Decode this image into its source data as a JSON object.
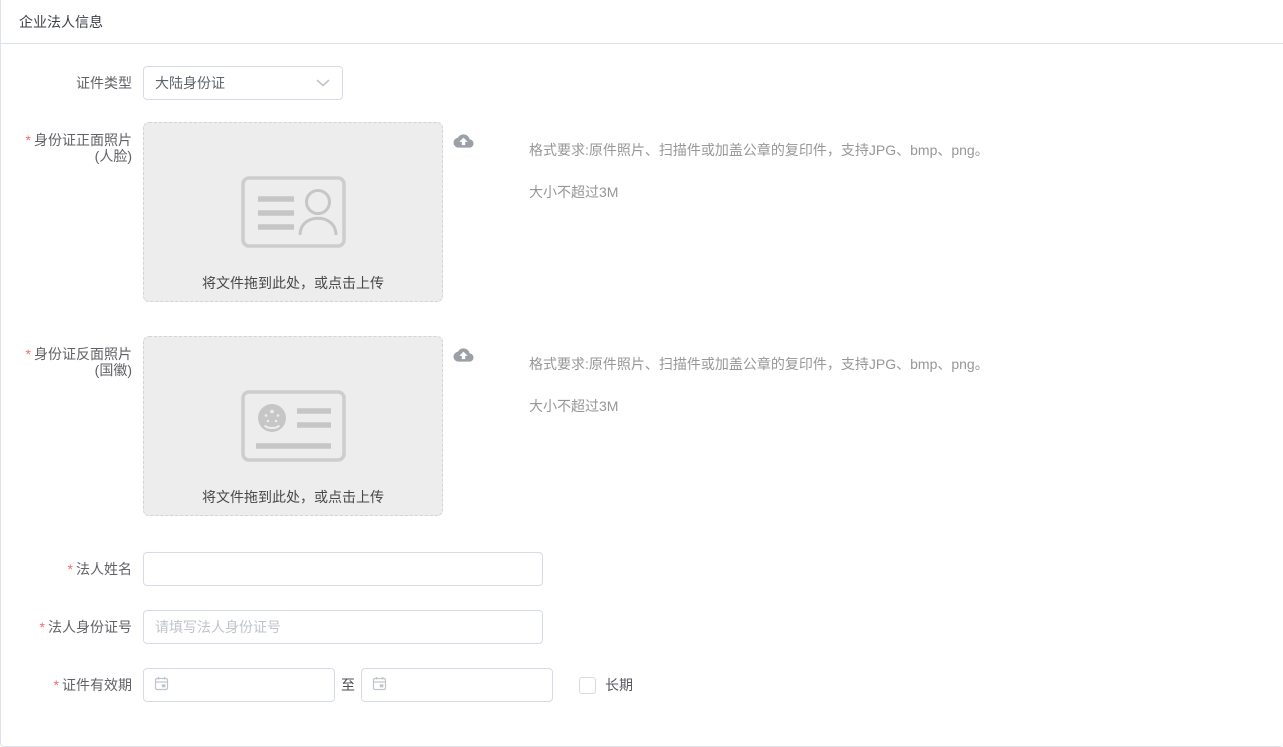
{
  "colors": {
    "panel_border": "#dde3ec",
    "required_mark": "#f56c6c",
    "input_border": "#d6dce6",
    "placeholder_text": "#c0c4cc",
    "label_text": "#606266",
    "hint_text": "#979797",
    "dropzone_bg": "#ededed",
    "dropzone_border": "#d4d4d4",
    "card_icon_gray": "#c6c6c6",
    "cloud_icon_gray": "#9aa0a6"
  },
  "header": {
    "title": "企业法人信息"
  },
  "required_mark": "*",
  "fields": {
    "cert_type": {
      "label": "证件类型",
      "value": "大陆身份证"
    },
    "id_front": {
      "label": "身份证正面照片",
      "label_sub": "(人脸)",
      "dropzone_text": "将文件拖到此处，或点击上传",
      "hint_line1": "格式要求:原件照片、扫描件或加盖公章的复印件，支持JPG、bmp、png。",
      "hint_line2": "大小不超过3M"
    },
    "id_back": {
      "label": "身份证反面照片",
      "label_sub": "(国徽)",
      "dropzone_text": "将文件拖到此处，或点击上传",
      "hint_line1": "格式要求:原件照片、扫描件或加盖公章的复印件，支持JPG、bmp、png。",
      "hint_line2": "大小不超过3M"
    },
    "legal_name": {
      "label": "法人姓名",
      "value": "",
      "placeholder": ""
    },
    "legal_id": {
      "label": "法人身份证号",
      "value": "",
      "placeholder": "请填写法人身份证号"
    },
    "validity": {
      "label": "证件有效期",
      "separator": "至",
      "start_value": "",
      "end_value": "",
      "checkbox_label": "长期",
      "checkbox_checked": false
    }
  }
}
